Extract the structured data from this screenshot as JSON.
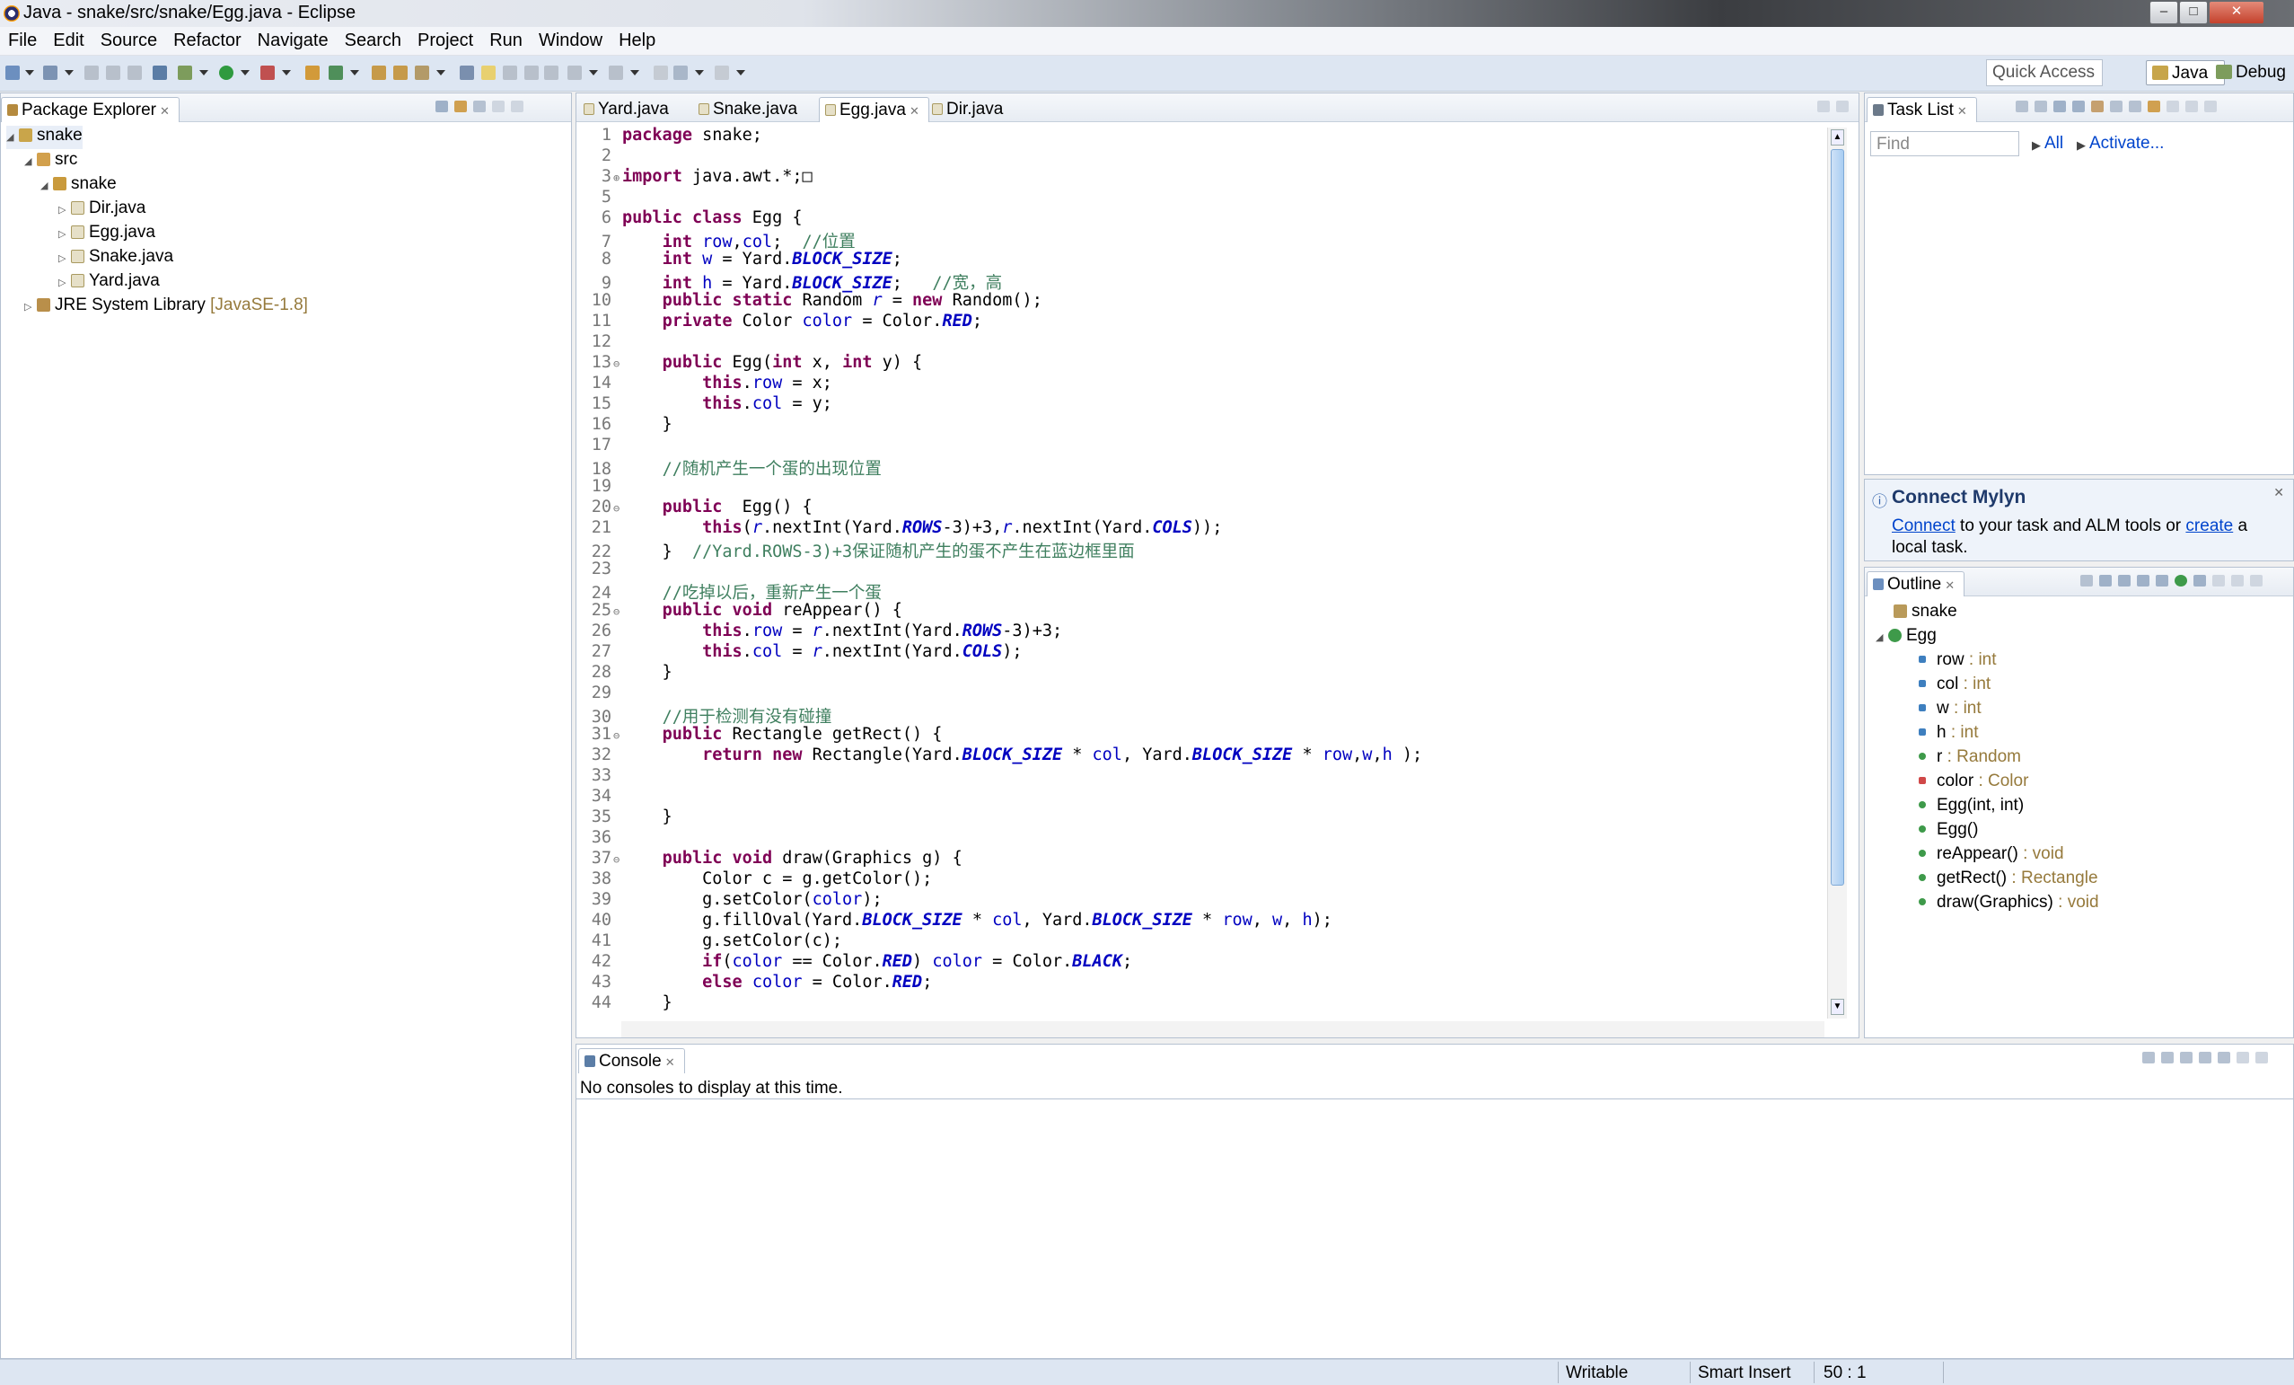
{
  "window": {
    "title": "Java - snake/src/snake/Egg.java - Eclipse",
    "min": "–",
    "max": "□",
    "close": "✕"
  },
  "menu": [
    "File",
    "Edit",
    "Source",
    "Refactor",
    "Navigate",
    "Search",
    "Project",
    "Run",
    "Window",
    "Help"
  ],
  "toolbar": {
    "quick_access_placeholder": "Quick Access",
    "perspectives": {
      "java": "Java",
      "debug": "Debug"
    }
  },
  "package_explorer": {
    "tab": "Package Explorer",
    "tree": {
      "project": "snake",
      "src": "src",
      "package": "snake",
      "files": [
        "Dir.java",
        "Egg.java",
        "Snake.java",
        "Yard.java"
      ],
      "jre": "JRE System Library",
      "jre_version": "[JavaSE-1.8]"
    }
  },
  "editor": {
    "tabs": [
      "Yard.java",
      "Snake.java",
      "Egg.java",
      "Dir.java"
    ],
    "active_tab": "Egg.java"
  },
  "task_list": {
    "tab": "Task List",
    "find_placeholder": "Find",
    "all": "All",
    "activate": "Activate..."
  },
  "mylyn": {
    "title": "Connect Mylyn",
    "connect": "Connect",
    "text_mid": " to your task and ALM tools or ",
    "create": "create",
    "text_end": " a local task."
  },
  "outline": {
    "tab": "Outline",
    "package": "snake",
    "class": "Egg",
    "members": [
      {
        "name": "row",
        "type": " : int"
      },
      {
        "name": "col",
        "type": " : int"
      },
      {
        "name": "w",
        "type": " : int"
      },
      {
        "name": "h",
        "type": " : int"
      },
      {
        "name": "r",
        "type": " : Random"
      },
      {
        "name": "color",
        "type": " : Color"
      },
      {
        "name": "Egg(int, int)",
        "type": ""
      },
      {
        "name": "Egg()",
        "type": ""
      },
      {
        "name": "reAppear()",
        "type": " : void"
      },
      {
        "name": "getRect()",
        "type": " : Rectangle"
      },
      {
        "name": "draw(Graphics)",
        "type": " : void"
      }
    ]
  },
  "console": {
    "tab": "Console",
    "message": "No consoles to display at this time."
  },
  "status": {
    "writable": "Writable",
    "insert_mode": "Smart Insert",
    "position": "50 : 1"
  },
  "colors": {
    "keyword": "#7f0055",
    "field": "#0000c0",
    "comment": "#3f7f5f",
    "toolbar_bg": "#dde6f2"
  }
}
